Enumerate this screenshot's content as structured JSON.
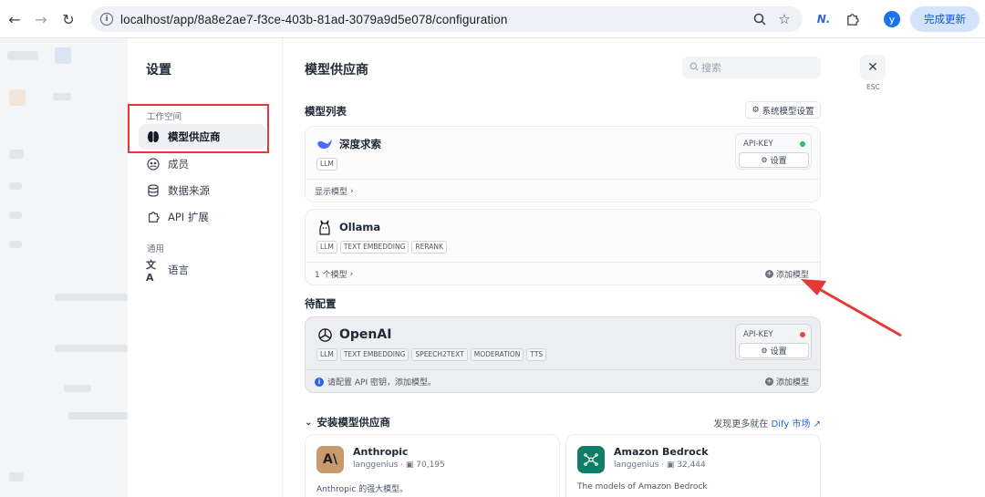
{
  "browser": {
    "url": "localhost/app/8a8e2ae7-f3ce-403b-81ad-3079a9d5e078/configuration",
    "update_label": "完成更新",
    "avatar_letter": "y",
    "brand_color": "#0b57d0"
  },
  "settings_nav": {
    "title": "设置",
    "group_workspace": "工作空间",
    "group_general": "通用",
    "items": [
      {
        "label": "模型供应商",
        "icon": "brain-icon",
        "active": true
      },
      {
        "label": "成员",
        "icon": "members-icon"
      },
      {
        "label": "数据来源",
        "icon": "database-icon"
      },
      {
        "label": "API 扩展",
        "icon": "puzzle-icon"
      },
      {
        "label": "语言",
        "icon": "translate-icon"
      }
    ]
  },
  "main": {
    "title": "模型供应商",
    "search_placeholder": "搜索",
    "model_list_label": "模型列表",
    "system_model_settings": "系统模型设置",
    "pending_label": "待配置",
    "install_label": "安装模型供应商",
    "market_prefix": "发现更多就在",
    "market_link": "Dify 市场",
    "esc_label": "ESC"
  },
  "providers": [
    {
      "name": "深度求索",
      "tags": [
        "LLM"
      ],
      "footer": "显示模型",
      "api_key_label": "API-KEY",
      "status_color": "#22c55e",
      "settings_label": "设置"
    },
    {
      "name": "Ollama",
      "tags": [
        "LLM",
        "TEXT EMBEDDING",
        "RERANK"
      ],
      "footer": "1 个模型",
      "add_model": "添加模型"
    }
  ],
  "pending": [
    {
      "name": "OpenAI",
      "tags": [
        "LLM",
        "TEXT EMBEDDING",
        "SPEECH2TEXT",
        "MODERATION",
        "TTS"
      ],
      "api_key_label": "API-KEY",
      "status_color": "#ef4444",
      "settings_label": "设置",
      "notice": "请配置 API 密钥，添加模型。",
      "add_model": "添加模型"
    }
  ],
  "plugins": [
    {
      "name": "Anthropic",
      "author": "langgenius",
      "installs": "70,195",
      "desc": "Anthropic 的强大模型。",
      "logo_text": "A\\",
      "logo_color": "#c89a6e"
    },
    {
      "name": "Amazon Bedrock",
      "author": "langgenius",
      "installs": "32,444",
      "desc": "The models of Amazon Bedrock",
      "logo_color": "#0f7d68"
    }
  ]
}
